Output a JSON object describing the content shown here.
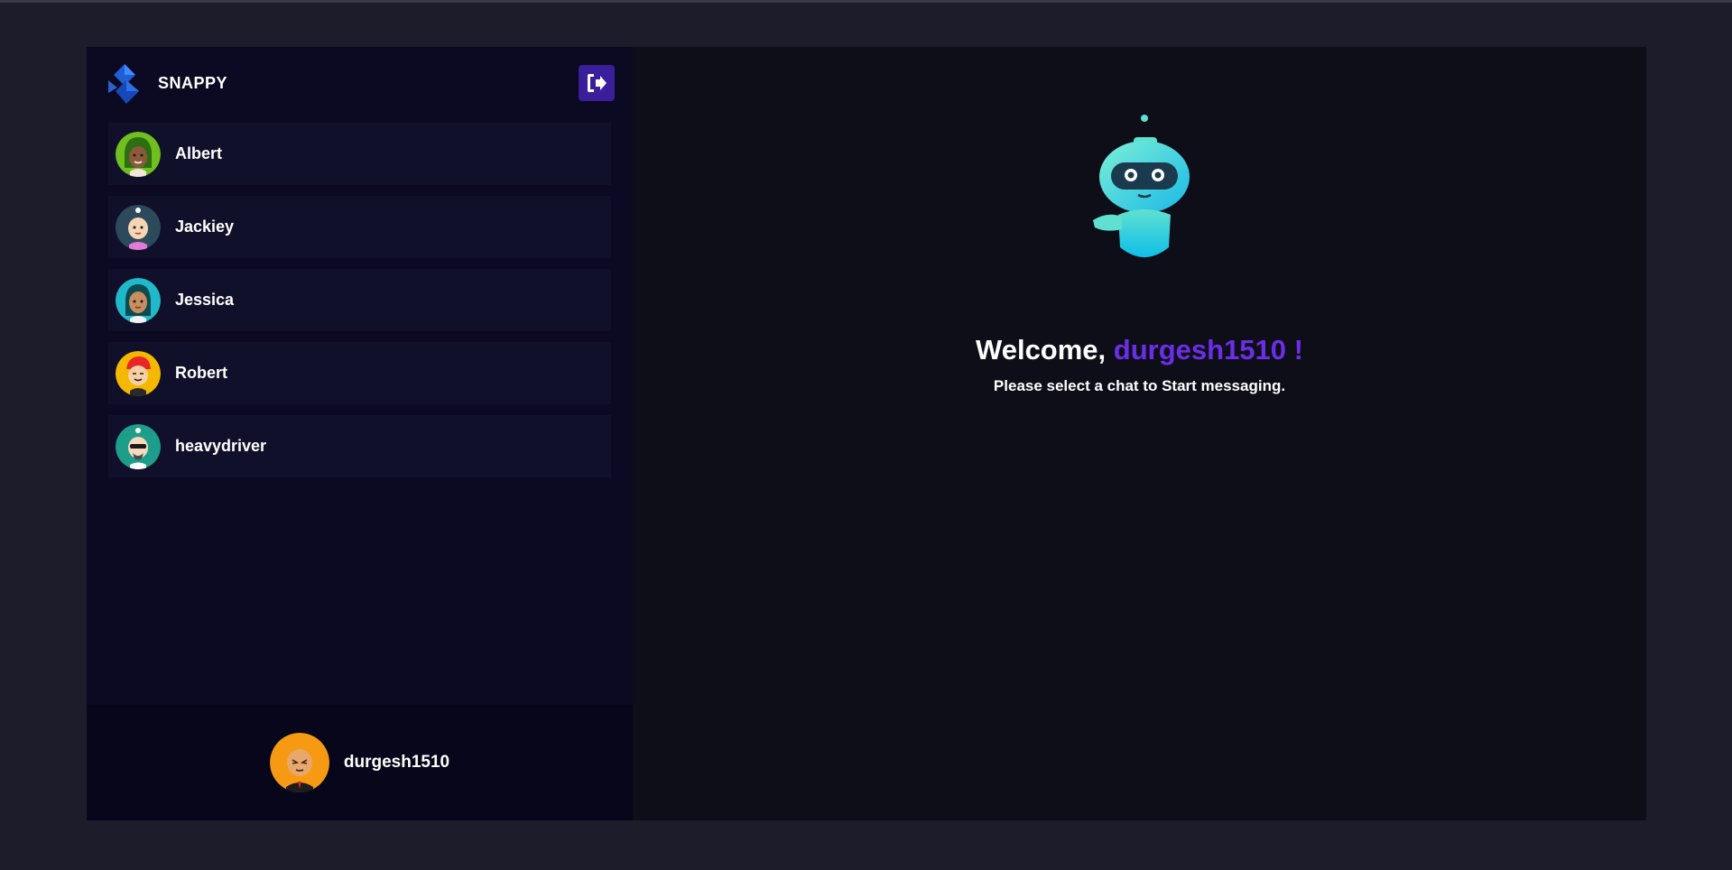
{
  "brand": {
    "name": "SNAPPY"
  },
  "contacts": [
    {
      "name": "Albert",
      "avatar_bg": "#6fbf1e",
      "skin": "#8a5a3b"
    },
    {
      "name": "Jackiey",
      "avatar_bg": "#2d4a5c",
      "skin": "#f5d6b4"
    },
    {
      "name": "Jessica",
      "avatar_bg": "#1fb9c9",
      "skin": "#c98e5e"
    },
    {
      "name": "Robert",
      "avatar_bg": "#f5b800",
      "skin": "#f6cfa5"
    },
    {
      "name": "heavydriver",
      "avatar_bg": "#1c9e8a",
      "skin": "#f6d9bf"
    }
  ],
  "current_user": {
    "name": "durgesh1510",
    "avatar_bg": "#f59a12"
  },
  "welcome": {
    "prefix": "Welcome, ",
    "username": "durgesh1510 !",
    "subtitle": "Please select a chat to Start messaging."
  },
  "icons": {
    "logout": "logout-icon",
    "logo": "snappy-logo-icon",
    "robot": "robot-illustration"
  },
  "colors": {
    "accent": "#6b2ee8",
    "logout_bg": "#3a1e9a",
    "sidebar_bg": "#0b0a22"
  }
}
